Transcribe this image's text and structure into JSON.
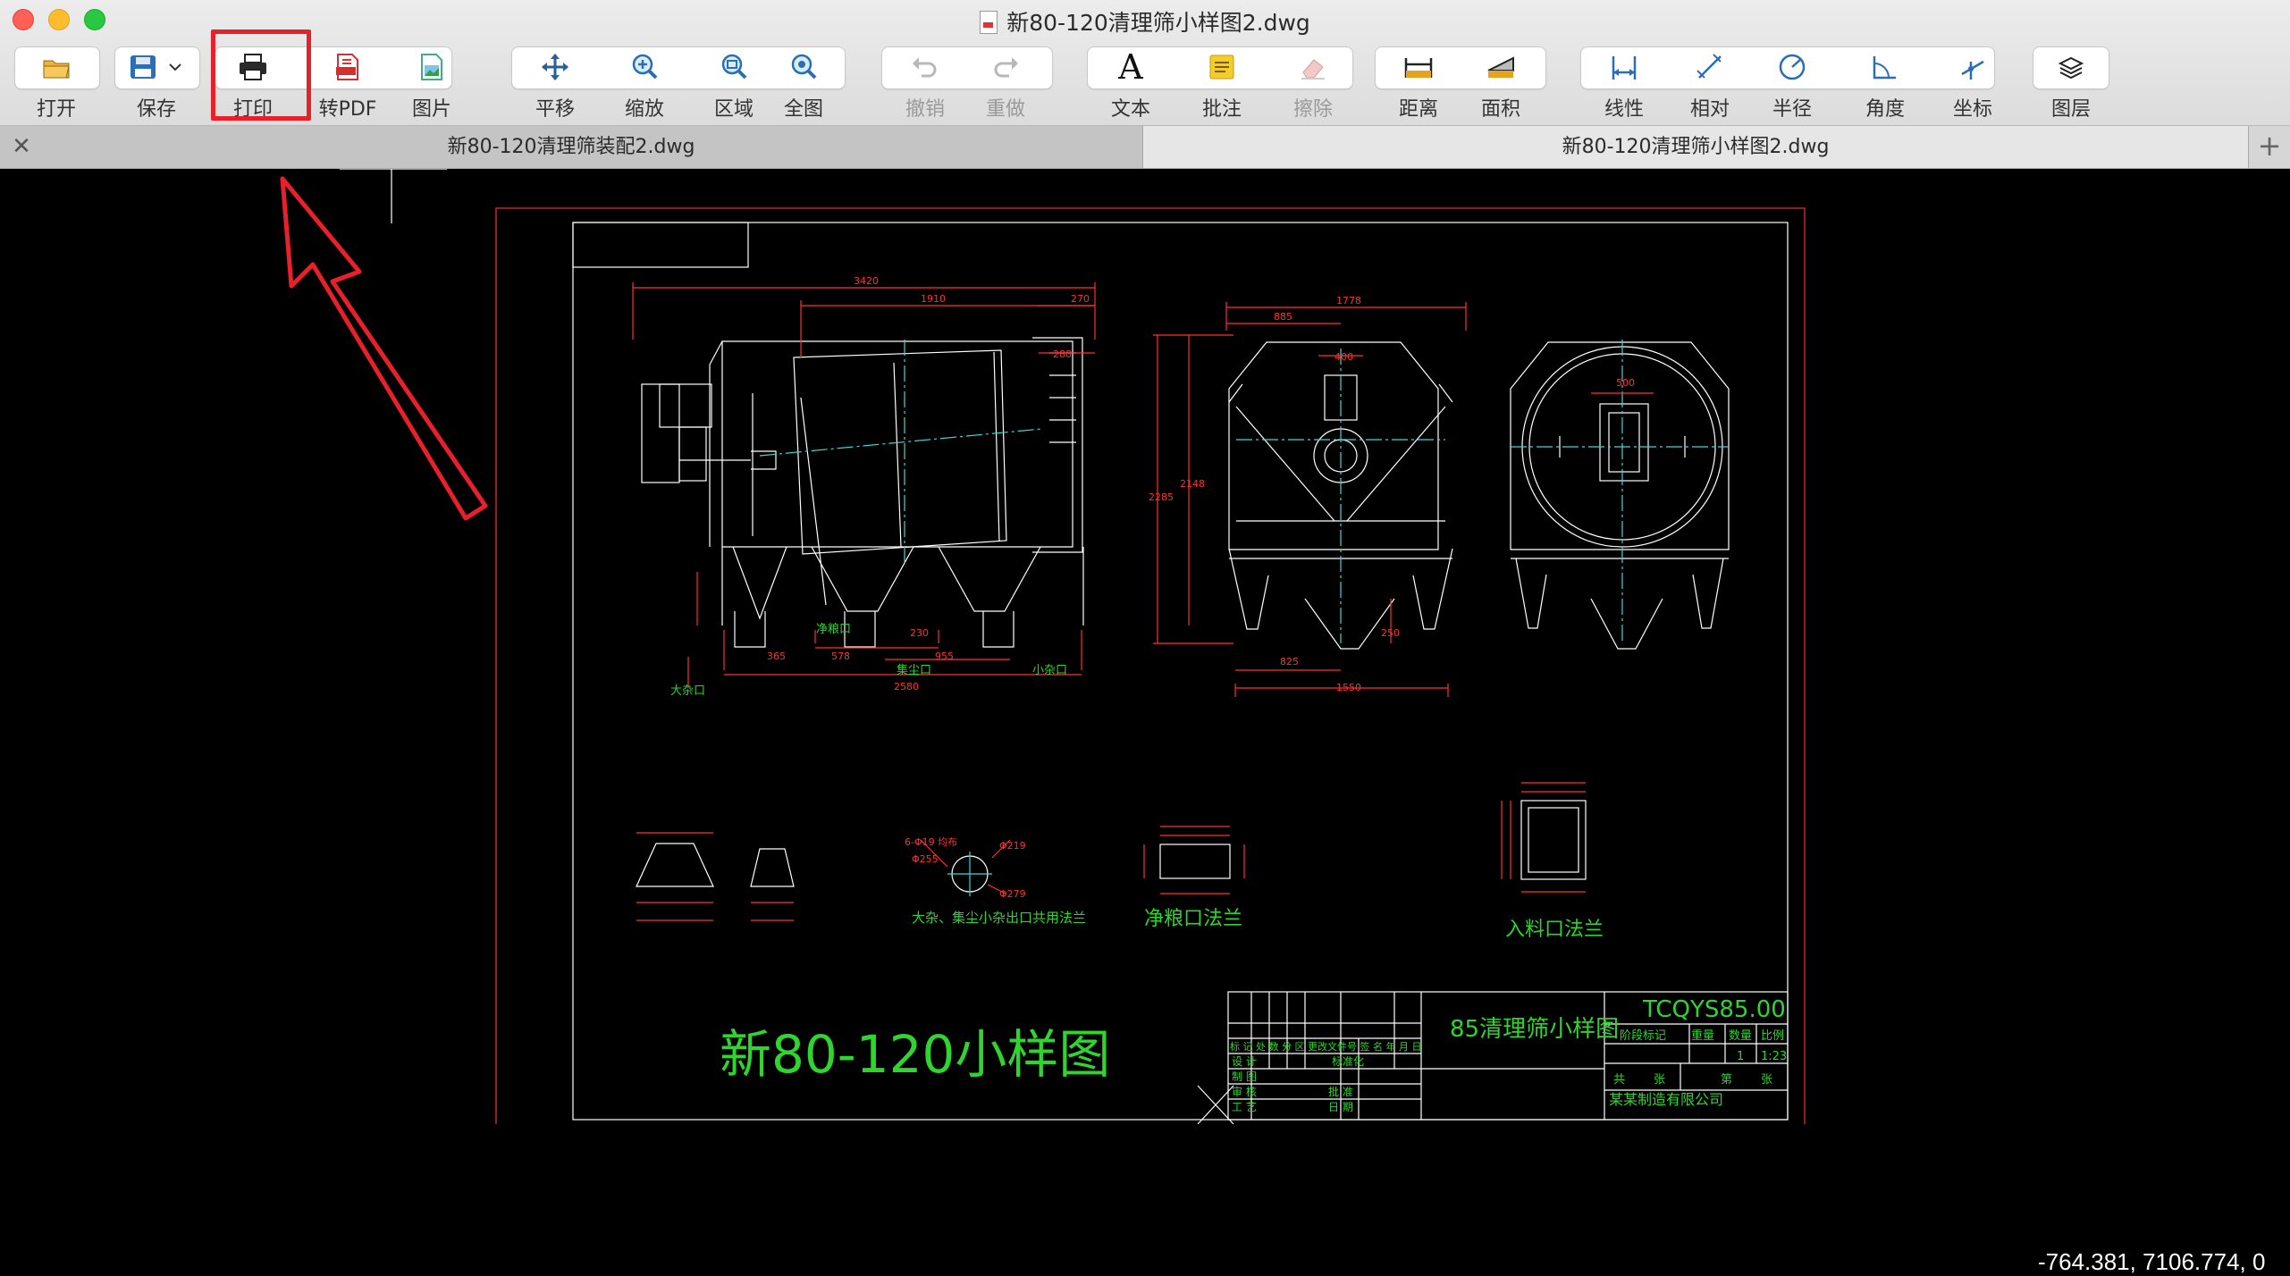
{
  "window": {
    "title": "新80-120清理筛小样图2.dwg"
  },
  "toolbar": {
    "open": "打开",
    "save": "保存",
    "print": "打印",
    "to_pdf": "转PDF",
    "image": "图片",
    "pan": "平移",
    "zoom": "缩放",
    "region": "区域",
    "full": "全图",
    "undo": "撤销",
    "redo": "重做",
    "text": "文本",
    "note": "批注",
    "erase": "擦除",
    "distance": "距离",
    "area": "面积",
    "linear": "线性",
    "relative": "相对",
    "radius": "半径",
    "angle": "角度",
    "coordinate": "坐标",
    "layers": "图层"
  },
  "tabs": [
    {
      "label": "新80-120清理筛装配2.dwg",
      "active": false
    },
    {
      "label": "新80-120清理筛小样图2.dwg",
      "active": true
    }
  ],
  "drawing": {
    "main_title": "新80-120小样图",
    "title_block_name": "85清理筛小样图",
    "drawing_code": "TCQYS85.00",
    "company": "某某制造有限公司",
    "labels": {
      "clean_grain_flange": "净粮口法兰",
      "inlet_flange": "入料口法兰",
      "large_small_outlet": "大杂、集尘小杂出口共用法兰",
      "clean_grain_port": "净粮口",
      "large_impurity_port": "大杂口",
      "dust_port": "集尘口",
      "small_impurity_port": "小杂口"
    },
    "dims": {
      "d3420": "3420",
      "d1910": "1910",
      "d270": "270",
      "d288": "288",
      "d1778": "1778",
      "d885": "885",
      "d400": "400",
      "d2285": "2285",
      "d2148": "2148",
      "d500": "500",
      "d365": "365",
      "d578": "578",
      "d955": "955",
      "d2580": "2580",
      "d230": "230",
      "d825": "825",
      "d1550": "1550",
      "d250": "250",
      "d6phi19": "6-Φ19 均布",
      "dphi219": "Φ219",
      "dphi255": "Φ255",
      "dphi279": "Φ279"
    },
    "title_block": {
      "mark": "阶段标记",
      "weight": "重量",
      "qty": "数量",
      "scale": "比例",
      "qty_val": "1",
      "scale_val": "1:23",
      "sheet_total": "共",
      "sheet_unit": "张",
      "sheet_no": "第",
      "sheet_unit2": "张",
      "rows": [
        "标 记 处 数 分 区 更改文件号 签 名 年 月 日",
        "设 计",
        "制 图",
        "审 核",
        "工 艺"
      ],
      "std": "标准化",
      "approve": "批 准",
      "date": "日 期"
    }
  },
  "status": {
    "coordinates": "-764.381, 7106.774, 0"
  },
  "colors": {
    "frame_red": "#ff2a2a",
    "drawing_white": "#ffffff",
    "dim_red": "#ff3030",
    "text_green": "#2fd42f",
    "center_cyan": "#3fd7d7",
    "annotation_red": "#e8202a"
  }
}
